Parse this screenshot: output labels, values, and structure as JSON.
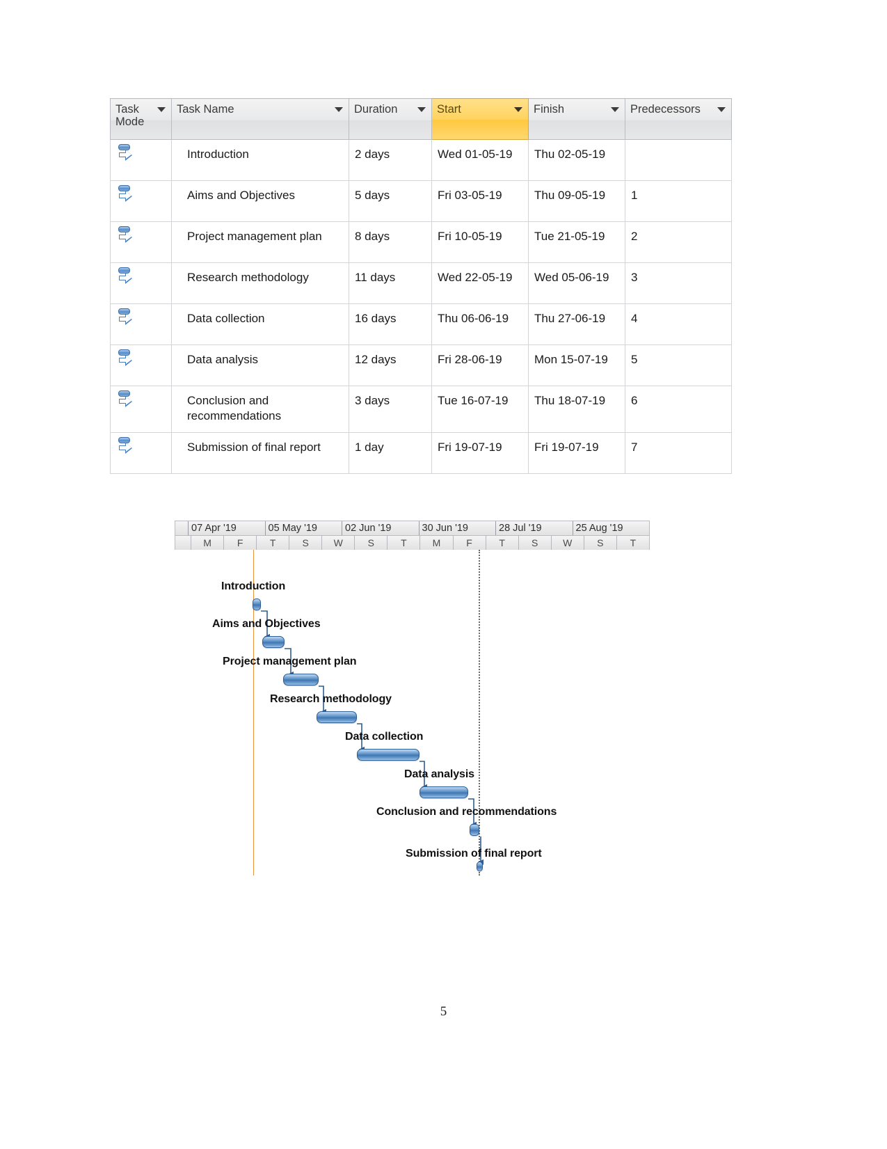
{
  "table": {
    "columns": [
      {
        "key": "task_mode",
        "label": "Task Mode",
        "highlighted": false
      },
      {
        "key": "task_name",
        "label": "Task Name",
        "highlighted": false
      },
      {
        "key": "duration",
        "label": "Duration",
        "highlighted": false
      },
      {
        "key": "start",
        "label": "Start",
        "highlighted": true
      },
      {
        "key": "finish",
        "label": "Finish",
        "highlighted": false
      },
      {
        "key": "predecessors",
        "label": "Predecessors",
        "highlighted": false
      }
    ],
    "highlight_color": "#FFD35E",
    "header_color": "#E8E9EA",
    "mode_icon": "auto-schedule-icon",
    "rows": [
      {
        "task_name": "Introduction",
        "duration": "2 days",
        "start": "Wed 01-05-19",
        "finish": "Thu 02-05-19",
        "predecessors": ""
      },
      {
        "task_name": "Aims and Objectives",
        "duration": "5 days",
        "start": "Fri 03-05-19",
        "finish": "Thu 09-05-19",
        "predecessors": "1"
      },
      {
        "task_name": "Project management plan",
        "duration": "8 days",
        "start": "Fri 10-05-19",
        "finish": "Tue 21-05-19",
        "predecessors": "2"
      },
      {
        "task_name": "Research methodology",
        "duration": "11 days",
        "start": "Wed 22-05-19",
        "finish": "Wed 05-06-19",
        "predecessors": "3"
      },
      {
        "task_name": "Data collection",
        "duration": "16 days",
        "start": "Thu 06-06-19",
        "finish": "Thu 27-06-19",
        "predecessors": "4"
      },
      {
        "task_name": "Data analysis",
        "duration": "12 days",
        "start": "Fri 28-06-19",
        "finish": "Mon 15-07-19",
        "predecessors": "5"
      },
      {
        "task_name": "Conclusion and recommendations",
        "duration": "3 days",
        "start": "Tue 16-07-19",
        "finish": "Thu 18-07-19",
        "predecessors": "6"
      },
      {
        "task_name": "Submission of final report",
        "duration": "1 day",
        "start": "Fri 19-07-19",
        "finish": "Fri 19-07-19",
        "predecessors": "7"
      }
    ]
  },
  "chart_data": {
    "type": "bar",
    "title": "",
    "xlabel": "",
    "ylabel": "",
    "grid": false,
    "timeline": {
      "major_ticks": [
        "07 Apr '19",
        "05 May '19",
        "02 Jun '19",
        "30 Jun '19",
        "28 Jul '19",
        "25 Aug '19"
      ],
      "minor_ticks": [
        "M",
        "F",
        "T",
        "S",
        "W",
        "S",
        "T",
        "M",
        "F",
        "T",
        "S",
        "W",
        "S",
        "T"
      ],
      "range_start": "07 Apr '19",
      "range_end": "25 Aug '19"
    },
    "markers": [
      {
        "name": "project-start-line",
        "label": "",
        "color": "#E8933B",
        "style": "solid"
      },
      {
        "name": "status-line",
        "label": "",
        "color": "#6A6A6A",
        "style": "dotted"
      }
    ],
    "categories": [
      "Introduction",
      "Aims and Objectives",
      "Project management plan",
      "Research methodology",
      "Data collection",
      "Data analysis",
      "Conclusion and recommendations",
      "Submission of final report"
    ],
    "bars": [
      {
        "label": "Introduction",
        "start": "Wed 01-05-19",
        "finish": "Thu 02-05-19",
        "duration_days": 2,
        "predecessor": ""
      },
      {
        "label": "Aims and Objectives",
        "start": "Fri 03-05-19",
        "finish": "Thu 09-05-19",
        "duration_days": 5,
        "predecessor": "1"
      },
      {
        "label": "Project management plan",
        "start": "Fri 10-05-19",
        "finish": "Tue 21-05-19",
        "duration_days": 8,
        "predecessor": "2"
      },
      {
        "label": "Research methodology",
        "start": "Wed 22-05-19",
        "finish": "Wed 05-06-19",
        "duration_days": 11,
        "predecessor": "3"
      },
      {
        "label": "Data collection",
        "start": "Thu 06-06-19",
        "finish": "Thu 27-06-19",
        "duration_days": 16,
        "predecessor": "4"
      },
      {
        "label": "Data analysis",
        "start": "Fri 28-06-19",
        "finish": "Mon 15-07-19",
        "duration_days": 12,
        "predecessor": "5"
      },
      {
        "label": "Conclusion and recommendations",
        "start": "Tue 16-07-19",
        "finish": "Thu 18-07-19",
        "duration_days": 3,
        "predecessor": "6"
      },
      {
        "label": "Submission of final report",
        "start": "Fri 19-07-19",
        "finish": "Fri 19-07-19",
        "duration_days": 1,
        "predecessor": "7"
      }
    ],
    "bar_color": "#4F85C0",
    "bar_border_color": "#2E5D91",
    "link_color": "#2E5D91"
  },
  "page": {
    "number": "5"
  }
}
